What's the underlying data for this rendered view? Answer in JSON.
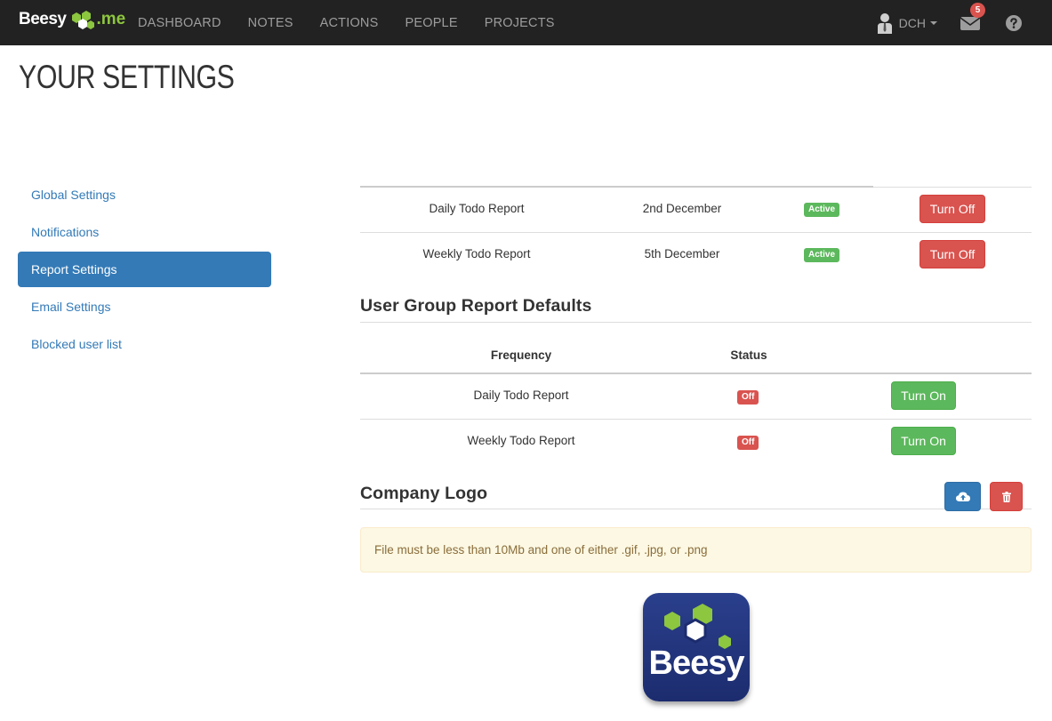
{
  "navbar": {
    "brand_prefix": "Beesy",
    "brand_suffix": ".me",
    "links": [
      "DASHBOARD",
      "NOTES",
      "ACTIONS",
      "PEOPLE",
      "PROJECTS"
    ],
    "user_label": "DCH",
    "mail_count": "5"
  },
  "page": {
    "title": "YOUR SETTINGS"
  },
  "sidebar": {
    "items": [
      {
        "label": "Global Settings",
        "active": false
      },
      {
        "label": "Notifications",
        "active": false
      },
      {
        "label": "Report Settings",
        "active": true
      },
      {
        "label": "Email Settings",
        "active": false
      },
      {
        "label": "Blocked user list",
        "active": false
      }
    ]
  },
  "reports": {
    "rows": [
      {
        "name": "Daily Todo Report",
        "date": "2nd December",
        "status": "Active",
        "action": "Turn Off"
      },
      {
        "name": "Weekly Todo Report",
        "date": "5th December",
        "status": "Active",
        "action": "Turn Off"
      }
    ]
  },
  "group_defaults": {
    "title": "User Group Report Defaults",
    "headers": {
      "frequency": "Frequency",
      "status": "Status"
    },
    "rows": [
      {
        "name": "Daily Todo Report",
        "status": "Off",
        "action": "Turn On"
      },
      {
        "name": "Weekly Todo Report",
        "status": "Off",
        "action": "Turn On"
      }
    ]
  },
  "company_logo": {
    "title": "Company Logo",
    "upload_icon": "cloud-upload-icon",
    "delete_icon": "trash-icon",
    "hint": "File must be less than 10Mb and one of either .gif, .jpg, or .png",
    "logo_text": "Beesy"
  },
  "colors": {
    "navbar_bg": "#222222",
    "brand_green": "#8dc63f",
    "primary": "#337ab7",
    "danger": "#d9534f",
    "success": "#5cb85c",
    "warning_bg": "#fcf8e3"
  }
}
